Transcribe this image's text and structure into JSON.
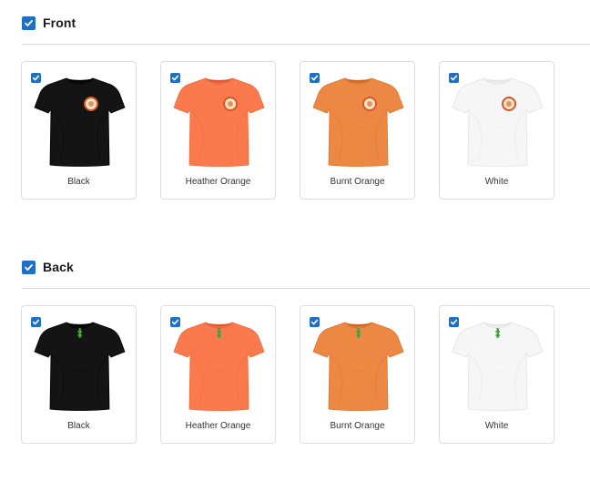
{
  "sections": [
    {
      "title": "Front",
      "design": "front",
      "variants": [
        {
          "label": "Black",
          "color": "#141414"
        },
        {
          "label": "Heather Orange",
          "color": "#fb7a4d"
        },
        {
          "label": "Burnt Orange",
          "color": "#ec8843"
        },
        {
          "label": "White",
          "color": "#f6f6f6"
        }
      ]
    },
    {
      "title": "Back",
      "design": "back",
      "variants": [
        {
          "label": "Black",
          "color": "#141414"
        },
        {
          "label": "Heather Orange",
          "color": "#fb7a4d"
        },
        {
          "label": "Burnt Orange",
          "color": "#ec8843"
        },
        {
          "label": "White",
          "color": "#f6f6f6"
        }
      ]
    }
  ],
  "colors": {
    "checkbox": "#1f6fc5",
    "divider": "#d9d9d9",
    "card_border": "#dedede",
    "logo_front_ring": "#d8552b",
    "logo_front_fill": "#f3e7c2",
    "logo_back": "#3fa43a"
  },
  "icons": {
    "checkbox": "checkmark-icon",
    "shirt": "tshirt-mockup",
    "front_logo": "round-badge-logo",
    "back_logo": "green-tag-logo"
  }
}
